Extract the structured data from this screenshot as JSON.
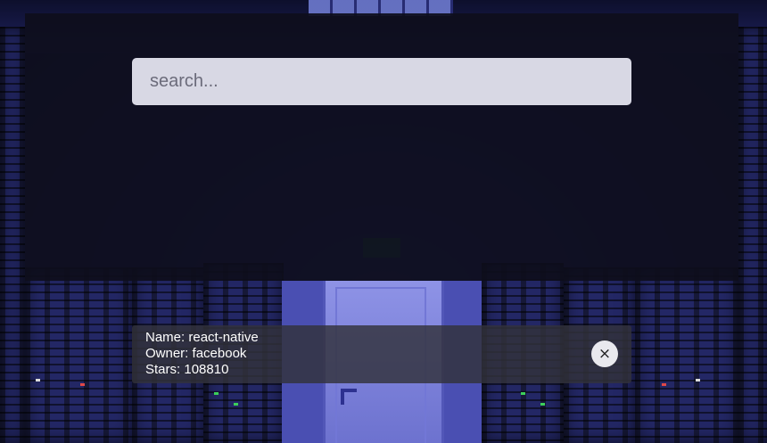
{
  "search": {
    "placeholder": "search...",
    "value": ""
  },
  "result": {
    "name_label": "Name:",
    "name_value": "react-native",
    "owner_label": "Owner:",
    "owner_value": "facebook",
    "stars_label": "Stars:",
    "stars_value": "108810",
    "remove_icon": "close-icon",
    "remove_glyph": "×"
  },
  "colors": {
    "panel_bg": "#0e0e1c",
    "search_bg": "#eeeefa",
    "card_bg": "#32323a",
    "accent_bg": "#242775"
  }
}
